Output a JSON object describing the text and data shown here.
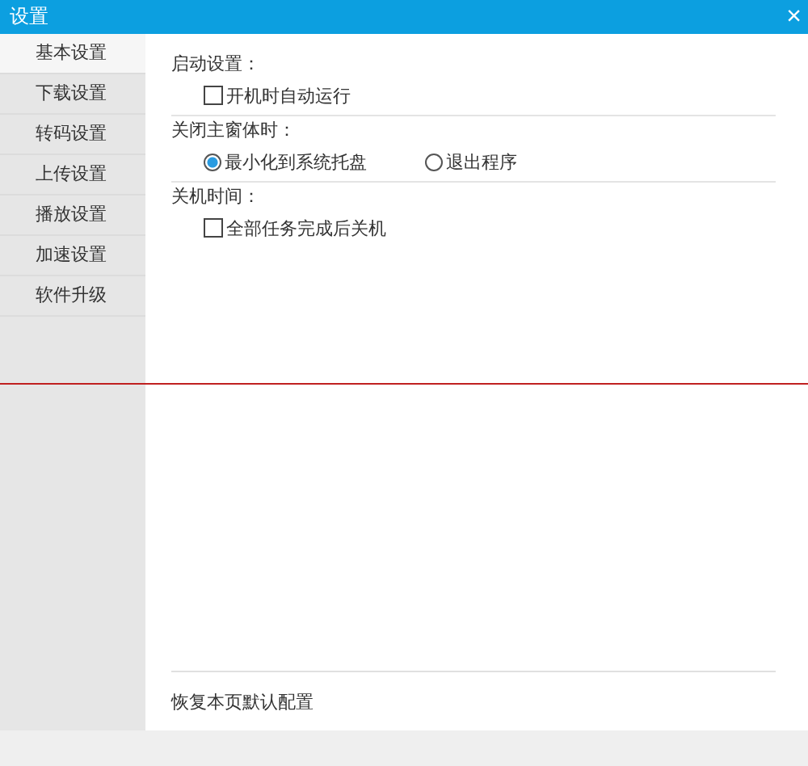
{
  "window": {
    "title": "设置",
    "close": "×"
  },
  "sidebar": {
    "items": [
      {
        "label": "基本设置",
        "selected": true
      },
      {
        "label": "下载设置",
        "selected": false
      },
      {
        "label": "转码设置",
        "selected": false
      },
      {
        "label": "上传设置",
        "selected": false
      },
      {
        "label": "播放设置",
        "selected": false
      },
      {
        "label": "加速设置",
        "selected": false
      },
      {
        "label": "软件升级",
        "selected": false
      }
    ]
  },
  "sections": [
    {
      "title": "启动设置：",
      "options": [
        {
          "kind": "checkbox",
          "label": "开机时自动运行",
          "checked": false
        }
      ]
    },
    {
      "title": "关闭主窗体时：",
      "options": [
        {
          "kind": "radio",
          "label": "最小化到系统托盘",
          "selected": true
        },
        {
          "kind": "radio",
          "label": "退出程序",
          "selected": false
        }
      ]
    },
    {
      "title": "关机时间：",
      "options": [
        {
          "kind": "checkbox",
          "label": "全部任务完成后关机",
          "checked": false
        }
      ]
    }
  ],
  "footer": {
    "restore_link": "恢复本页默认配置"
  }
}
